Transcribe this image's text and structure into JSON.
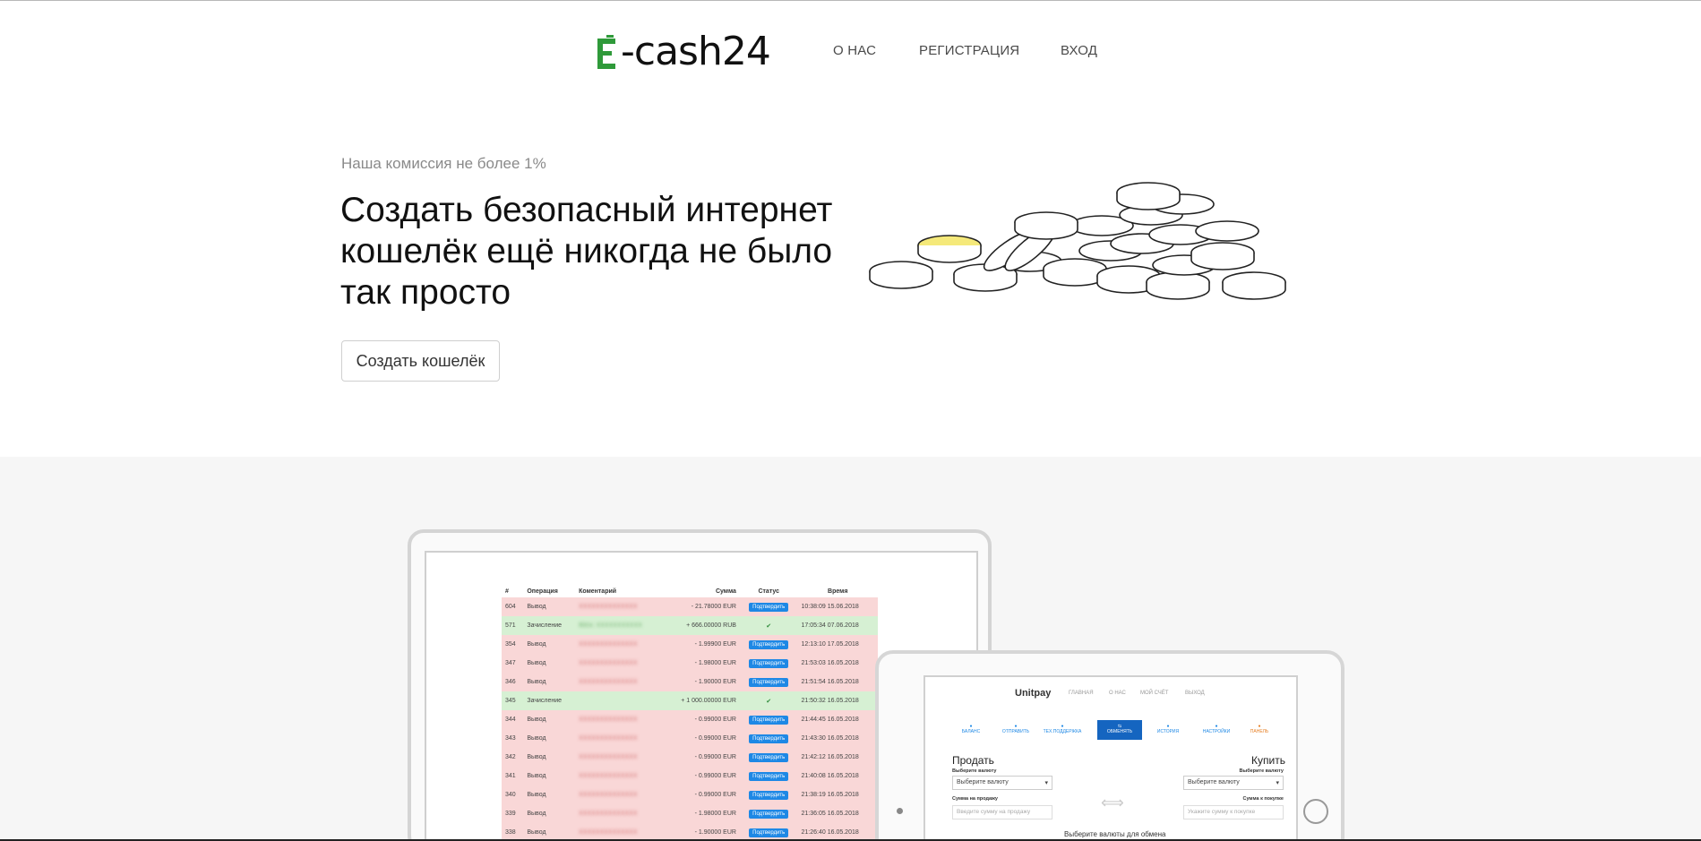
{
  "logo": {
    "text": "-cash24",
    "brand_color": "#2f9a3a"
  },
  "nav": {
    "items": [
      {
        "label": "О НАС"
      },
      {
        "label": "РЕГИСТРАЦИЯ"
      },
      {
        "label": "ВХОД"
      }
    ]
  },
  "hero": {
    "subtitle": "Наша комиссия не более 1%",
    "title": "Создать безопасный интернет кошелёк ещё никогда не было так просто",
    "button": "Создать кошелёк",
    "coin_accent_color": "#f5e97a"
  },
  "laptop_table": {
    "headers": [
      "#",
      "Операция",
      "Коментарий",
      "Сумма",
      "Статус",
      "Время"
    ],
    "confirm_label": "Подтвердить",
    "rows": [
      {
        "id": "604",
        "op": "Вывод",
        "comment": "XXXXXXXXXXXXXX",
        "amount": "- 21.78000 EUR",
        "status": "btn",
        "time": "10:38:09 15.06.2018",
        "kind": "red"
      },
      {
        "id": "571",
        "op": "Зачисление",
        "comment": "Bitrix: XXXXXXXXXXX",
        "amount": "+ 666.00000 RUB",
        "status": "ok",
        "time": "17:05:34 07.06.2018",
        "kind": "green"
      },
      {
        "id": "354",
        "op": "Вывод",
        "comment": "XXXXXXXXXXXXXX",
        "amount": "- 1.99900 EUR",
        "status": "btn",
        "time": "12:13:10 17.05.2018",
        "kind": "red"
      },
      {
        "id": "347",
        "op": "Вывод",
        "comment": "XXXXXXXXXXXXXX",
        "amount": "- 1.98000 EUR",
        "status": "btn",
        "time": "21:53:03 16.05.2018",
        "kind": "red"
      },
      {
        "id": "346",
        "op": "Вывод",
        "comment": "XXXXXXXXXXXXXX",
        "amount": "- 1.90000 EUR",
        "status": "btn",
        "time": "21:51:54 16.05.2018",
        "kind": "red"
      },
      {
        "id": "345",
        "op": "Зачисление",
        "comment": "",
        "amount": "+ 1 000.00000 EUR",
        "status": "ok",
        "time": "21:50:32 16.05.2018",
        "kind": "green"
      },
      {
        "id": "344",
        "op": "Вывод",
        "comment": "XXXXXXXXXXXXXX",
        "amount": "- 0.99000 EUR",
        "status": "btn",
        "time": "21:44:45 16.05.2018",
        "kind": "red"
      },
      {
        "id": "343",
        "op": "Вывод",
        "comment": "XXXXXXXXXXXXXX",
        "amount": "- 0.99000 EUR",
        "status": "btn",
        "time": "21:43:30 16.05.2018",
        "kind": "red"
      },
      {
        "id": "342",
        "op": "Вывод",
        "comment": "XXXXXXXXXXXXXX",
        "amount": "- 0.99000 EUR",
        "status": "btn",
        "time": "21:42:12 16.05.2018",
        "kind": "red"
      },
      {
        "id": "341",
        "op": "Вывод",
        "comment": "XXXXXXXXXXXXXX",
        "amount": "- 0.99000 EUR",
        "status": "btn",
        "time": "21:40:08 16.05.2018",
        "kind": "red"
      },
      {
        "id": "340",
        "op": "Вывод",
        "comment": "XXXXXXXXXXXXXX",
        "amount": "- 0.99000 EUR",
        "status": "btn",
        "time": "21:38:19 16.05.2018",
        "kind": "red"
      },
      {
        "id": "339",
        "op": "Вывод",
        "comment": "XXXXXXXXXXXXXX",
        "amount": "- 1.98000 EUR",
        "status": "btn",
        "time": "21:36:05 16.05.2018",
        "kind": "red"
      },
      {
        "id": "338",
        "op": "Вывод",
        "comment": "XXXXXXXXXXXXXX",
        "amount": "- 1.90000 EUR",
        "status": "btn",
        "time": "21:26:40 16.05.2018",
        "kind": "red"
      }
    ]
  },
  "tablet": {
    "brand": "Unitpay",
    "nav": [
      "ГЛАВНАЯ",
      "О НАС",
      "МОЙ СЧЁТ",
      "ВЫХОД"
    ],
    "menu": [
      "БАЛАНС",
      "ОТПРАВИТЬ",
      "ТЕХ.ПОДДЕРЖКА",
      "ОБМЕНЯТЬ",
      "ИСТОРИЯ",
      "НАСТРОЙКИ",
      "ПАНЕЛЬ"
    ],
    "sell_title": "Продать",
    "buy_title": "Купить",
    "choose_currency_label": "Выберите валюту",
    "choose_currency_value": "Выберите валюту",
    "sell_amount_label": "Сумма на продажу",
    "sell_amount_placeholder": "Введите сумму на продажу",
    "buy_amount_label": "Сумма к покупке",
    "buy_amount_placeholder": "Укажите сумму к покупке",
    "footer_text": "Выберите валюты для обмена"
  }
}
